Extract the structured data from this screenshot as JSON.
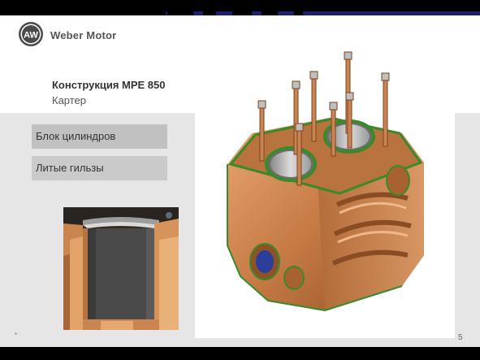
{
  "brand": {
    "name": "Weber Motor",
    "logo_letters": "AW"
  },
  "slide": {
    "title": "Конструкция MPE 850",
    "subtitle": "Картер",
    "page_number": "5",
    "footer_mark": "*"
  },
  "menu": {
    "items": [
      {
        "label": "Блок цилиндров"
      },
      {
        "label": "Литые гильзы"
      }
    ]
  },
  "colors": {
    "accent": "#1d1f6b",
    "menu_bg": "#cacaca",
    "panel_bg": "#e6e6e6",
    "copper": "#c77b45",
    "green_seal": "#3a8a2a"
  }
}
